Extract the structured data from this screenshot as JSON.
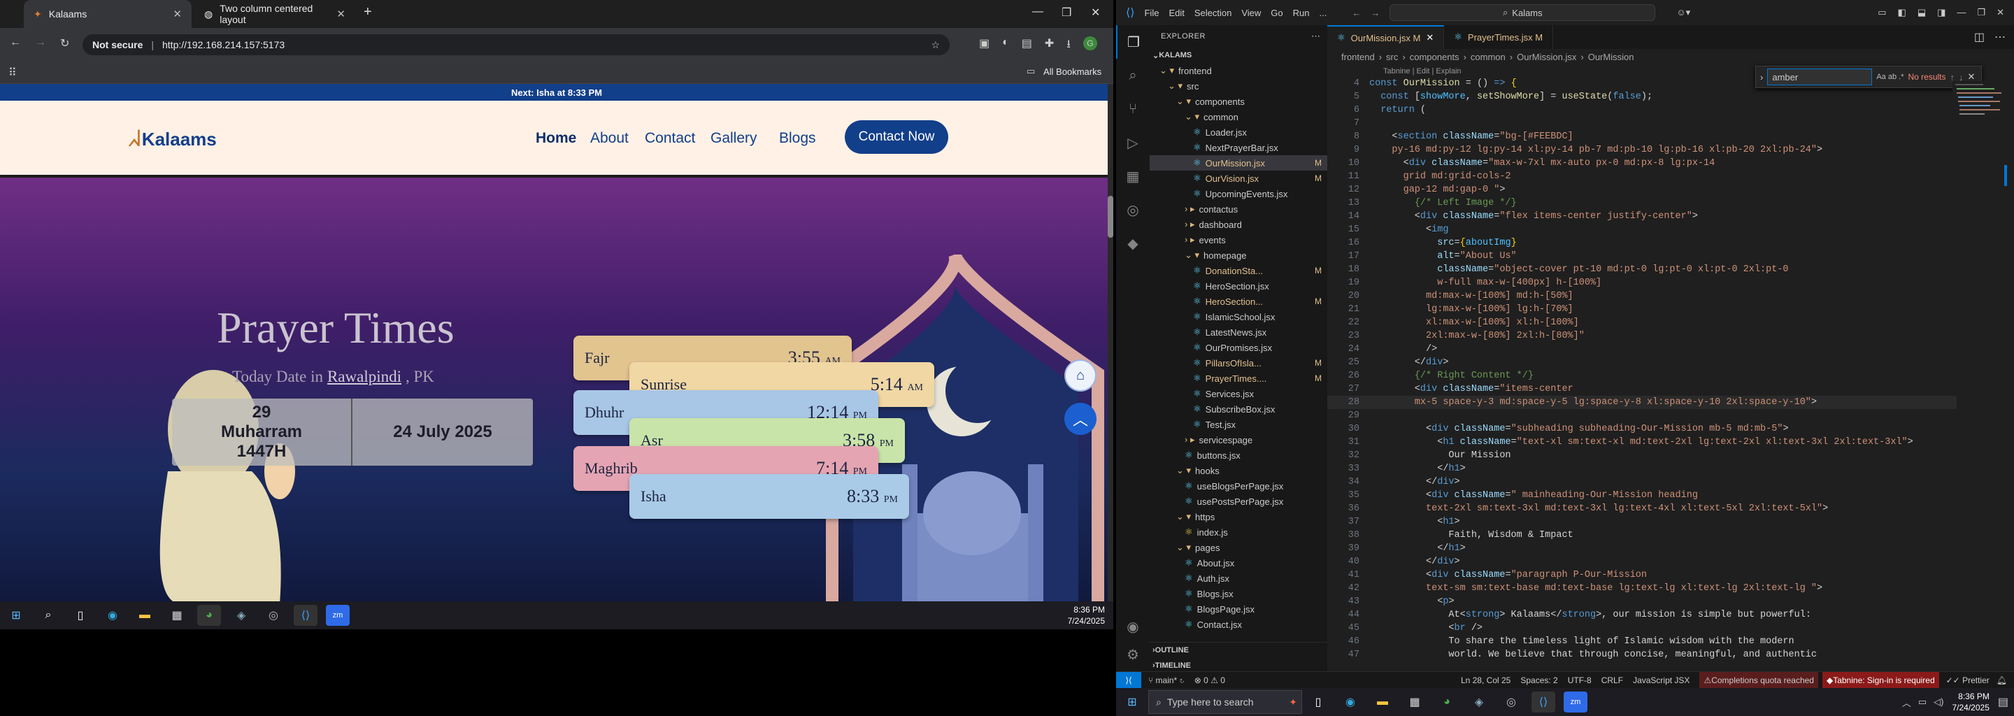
{
  "browser": {
    "tabs": [
      {
        "title": "Kalaams"
      },
      {
        "title": "Two column centered layout"
      }
    ],
    "security": "Not secure",
    "url": "http://192.168.214.157:5173",
    "bookmarks_label": "All Bookmarks"
  },
  "site": {
    "announcement": "Next: Isha at 8:33 PM",
    "logo_text": "Kalaams",
    "nav": [
      "Home",
      "About",
      "Contact",
      "Gallery",
      "Blogs"
    ],
    "contact_button": "Contact Now",
    "hero_title": "Prayer Times",
    "today_label": "Today Date in",
    "city": "Rawalpindi",
    "country": ", PK",
    "hijri_date": "29 Muharram 1447H",
    "gregorian_date": "24 July 2025",
    "prayers": [
      {
        "name": "Fajr",
        "time": "3:55",
        "ampm": "AM"
      },
      {
        "name": "Sunrise",
        "time": "5:14",
        "ampm": "AM"
      },
      {
        "name": "Dhuhr",
        "time": "12:14",
        "ampm": "PM"
      },
      {
        "name": "Asr",
        "time": "3:58",
        "ampm": "PM"
      },
      {
        "name": "Maghrib",
        "time": "7:14",
        "ampm": "PM"
      },
      {
        "name": "Isha",
        "time": "8:33",
        "ampm": "PM"
      }
    ]
  },
  "taskbar_left": {
    "time": "8:36 PM",
    "date": "7/24/2025"
  },
  "vscode": {
    "menu": [
      "File",
      "Edit",
      "Selection",
      "View",
      "Go",
      "Run",
      "..."
    ],
    "search_box": "Kalams",
    "explorer_title": "EXPLORER",
    "root": "KALAMS",
    "tree": [
      {
        "label": "frontend",
        "type": "folder",
        "depth": 0
      },
      {
        "label": "src",
        "type": "folder",
        "depth": 1
      },
      {
        "label": "components",
        "type": "folder",
        "depth": 2
      },
      {
        "label": "common",
        "type": "folder",
        "depth": 3
      },
      {
        "label": "Loader.jsx",
        "type": "file",
        "depth": 4,
        "mark": ""
      },
      {
        "label": "NextPrayerBar.jsx",
        "type": "file",
        "depth": 4,
        "mark": ""
      },
      {
        "label": "OurMission.jsx",
        "type": "file",
        "depth": 4,
        "mark": "M",
        "active": true
      },
      {
        "label": "OurVision.jsx",
        "type": "file",
        "depth": 4,
        "mark": "M"
      },
      {
        "label": "UpcomingEvents.jsx",
        "type": "file",
        "depth": 4,
        "mark": ""
      },
      {
        "label": "contactus",
        "type": "cfolder",
        "depth": 3
      },
      {
        "label": "dashboard",
        "type": "cfolder",
        "depth": 3
      },
      {
        "label": "events",
        "type": "cfolder",
        "depth": 3
      },
      {
        "label": "homepage",
        "type": "folder",
        "depth": 3
      },
      {
        "label": "DonationSta...",
        "type": "file",
        "depth": 4,
        "mark": "M"
      },
      {
        "label": "HeroSection.jsx",
        "type": "file",
        "depth": 4,
        "mark": ""
      },
      {
        "label": "HeroSection...",
        "type": "file",
        "depth": 4,
        "mark": "M"
      },
      {
        "label": "IslamicSchool.jsx",
        "type": "file",
        "depth": 4,
        "mark": ""
      },
      {
        "label": "LatestNews.jsx",
        "type": "file",
        "depth": 4,
        "mark": ""
      },
      {
        "label": "OurPromises.jsx",
        "type": "file",
        "depth": 4,
        "mark": ""
      },
      {
        "label": "PillarsOfIsla...",
        "type": "file",
        "depth": 4,
        "mark": "M"
      },
      {
        "label": "PrayerTimes....",
        "type": "file",
        "depth": 4,
        "mark": "M"
      },
      {
        "label": "Services.jsx",
        "type": "file",
        "depth": 4,
        "mark": ""
      },
      {
        "label": "SubscribeBox.jsx",
        "type": "file",
        "depth": 4,
        "mark": ""
      },
      {
        "label": "Test.jsx",
        "type": "file",
        "depth": 4,
        "mark": ""
      },
      {
        "label": "servicespage",
        "type": "cfolder",
        "depth": 3
      },
      {
        "label": "buttons.jsx",
        "type": "file",
        "depth": 3,
        "mark": ""
      },
      {
        "label": "hooks",
        "type": "folder",
        "depth": 2
      },
      {
        "label": "useBlogsPerPage.jsx",
        "type": "file",
        "depth": 3,
        "mark": ""
      },
      {
        "label": "usePostsPerPage.jsx",
        "type": "file",
        "depth": 3,
        "mark": ""
      },
      {
        "label": "https",
        "type": "folder",
        "depth": 2
      },
      {
        "label": "index.js",
        "type": "file",
        "depth": 3,
        "mark": ""
      },
      {
        "label": "pages",
        "type": "folder",
        "depth": 2
      },
      {
        "label": "About.jsx",
        "type": "file",
        "depth": 3,
        "mark": ""
      },
      {
        "label": "Auth.jsx",
        "type": "file",
        "depth": 3,
        "mark": ""
      },
      {
        "label": "Blogs.jsx",
        "type": "file",
        "depth": 3,
        "mark": ""
      },
      {
        "label": "BlogsPage.jsx",
        "type": "file",
        "depth": 3,
        "mark": ""
      },
      {
        "label": "Contact.jsx",
        "type": "file",
        "depth": 3,
        "mark": ""
      }
    ],
    "outline": "OUTLINE",
    "timeline": "TIMELINE",
    "editor_tabs": [
      {
        "label": "OurMission.jsx M",
        "active": true
      },
      {
        "label": "PrayerTimes.jsx M",
        "active": false
      }
    ],
    "breadcrumb": [
      "frontend",
      "src",
      "components",
      "common",
      "OurMission.jsx",
      "OurMission"
    ],
    "codelens": "Tabnine | Edit | Explain",
    "find": {
      "query": "amber",
      "result": "No results"
    },
    "code_lines": [
      {
        "n": 4,
        "h": "<span class='kw'>const</span> <span class='fn'>OurMission</span> = () <span class='kw'>=&gt;</span> <span class='pu'>{</span>"
      },
      {
        "n": 5,
        "h": "  <span class='kw'>const</span> [<span class='vr'>showMore</span>, <span class='fn'>setShowMore</span>] = <span class='fn'>useState</span>(<span class='kw'>false</span>);"
      },
      {
        "n": 6,
        "h": "  <span class='kw'>return</span> ("
      },
      {
        "n": 7,
        "h": ""
      },
      {
        "n": 8,
        "h": "    &lt;<span class='tg'>section</span> <span class='at'>className</span>=<span class='st'>\"bg-[#FEEBDC]</span>"
      },
      {
        "n": 9,
        "h": "<span class='st'>    py-16 md:py-12 lg:py-14 xl:py-14 pb-7 md:pb-10 lg:pb-16 xl:pb-20 2xl:pb-24\"</span>&gt;"
      },
      {
        "n": 10,
        "h": "      &lt;<span class='tg'>div</span> <span class='at'>className</span>=<span class='st'>\"max-w-7xl mx-auto px-0 md:px-8 lg:px-14</span>"
      },
      {
        "n": 11,
        "h": "<span class='st'>      grid md:grid-cols-2</span>"
      },
      {
        "n": 12,
        "h": "<span class='st'>      gap-12 md:gap-0 \"</span>&gt;"
      },
      {
        "n": 13,
        "h": "        <span class='cm'>{/* Left Image */}</span>"
      },
      {
        "n": 14,
        "h": "        &lt;<span class='tg'>div</span> <span class='at'>className</span>=<span class='st'>\"flex items-center justify-center\"</span>&gt;"
      },
      {
        "n": 15,
        "h": "          &lt;<span class='tg'>img</span>"
      },
      {
        "n": 16,
        "h": "            <span class='at'>src</span>=<span class='pu'>{</span><span class='vr'>aboutImg</span><span class='pu'>}</span>"
      },
      {
        "n": 17,
        "h": "            <span class='at'>alt</span>=<span class='st'>\"About Us\"</span>"
      },
      {
        "n": 18,
        "h": "            <span class='at'>className</span>=<span class='st'>\"object-cover pt-10 md:pt-0 lg:pt-0 xl:pt-0 2xl:pt-0</span>"
      },
      {
        "n": 19,
        "h": "<span class='st'>            w-full max-w-[400px] h-[100%]</span>"
      },
      {
        "n": 20,
        "h": "<span class='st'>          md:max-w-[100%] md:h-[50%]</span>"
      },
      {
        "n": 21,
        "h": "<span class='st'>          lg:max-w-[100%] lg:h-[70%]</span>"
      },
      {
        "n": 22,
        "h": "<span class='st'>          xl:max-w-[100%] xl:h-[100%]</span>"
      },
      {
        "n": 23,
        "h": "<span class='st'>          2xl:max-w-[80%] 2xl:h-[80%]\"</span>"
      },
      {
        "n": 24,
        "h": "          /&gt;"
      },
      {
        "n": 25,
        "h": "        &lt;/<span class='tg'>div</span>&gt;"
      },
      {
        "n": 26,
        "h": "        <span class='cm'>{/* Right Content */}</span>"
      },
      {
        "n": 27,
        "h": "        &lt;<span class='tg'>div</span> <span class='at'>className</span>=<span class='st'>\"items-center</span>"
      },
      {
        "n": 28,
        "h": "<span class='st'>        mx-5 space-y-3 md:space-y-5 lg:space-y-8 xl:space-y-10 2xl:space-y-10\"</span>&gt;"
      },
      {
        "n": 29,
        "h": ""
      },
      {
        "n": 30,
        "h": "          &lt;<span class='tg'>div</span> <span class='at'>className</span>=<span class='st'>\"subheading subheading-Our-Mission mb-5 md:mb-5\"</span>&gt;"
      },
      {
        "n": 31,
        "h": "            &lt;<span class='tg'>h1</span> <span class='at'>className</span>=<span class='st'>\"text-xl sm:text-xl md:text-2xl lg:text-2xl xl:text-3xl 2xl:text-3xl\"</span>&gt;"
      },
      {
        "n": 32,
        "h": "              Our Mission"
      },
      {
        "n": 33,
        "h": "            &lt;/<span class='tg'>h1</span>&gt;"
      },
      {
        "n": 34,
        "h": "          &lt;/<span class='tg'>div</span>&gt;"
      },
      {
        "n": 35,
        "h": "          &lt;<span class='tg'>div</span> <span class='at'>className</span>=<span class='st'>\" mainheading-Our-Mission heading</span>"
      },
      {
        "n": 36,
        "h": "<span class='st'>          text-2xl sm:text-3xl md:text-3xl lg:text-4xl xl:text-5xl 2xl:text-5xl\"</span>&gt;"
      },
      {
        "n": 37,
        "h": "            &lt;<span class='tg'>h1</span>&gt;"
      },
      {
        "n": 38,
        "h": "              Faith, Wisdom &amp; Impact"
      },
      {
        "n": 39,
        "h": "            &lt;/<span class='tg'>h1</span>&gt;"
      },
      {
        "n": 40,
        "h": "          &lt;/<span class='tg'>div</span>&gt;"
      },
      {
        "n": 41,
        "h": "          &lt;<span class='tg'>div</span> <span class='at'>className</span>=<span class='st'>\"paragraph P-Our-Mission</span>"
      },
      {
        "n": 42,
        "h": "<span class='st'>          text-sm sm:text-base md:text-base lg:text-lg xl:text-lg 2xl:text-lg \"</span>&gt;"
      },
      {
        "n": 43,
        "h": "            &lt;<span class='tg'>p</span>&gt;"
      },
      {
        "n": 44,
        "h": "              At&lt;<span class='tg'>strong</span>&gt; Kalaams&lt;/<span class='tg'>strong</span>&gt;, our mission is simple but powerful:"
      },
      {
        "n": 45,
        "h": "              &lt;<span class='tg'>br</span> /&gt;"
      },
      {
        "n": 46,
        "h": "              To share the timeless light of Islamic wisdom with the modern"
      },
      {
        "n": 47,
        "h": "              world. We believe that through concise, meaningful, and authentic"
      }
    ],
    "status": {
      "branch": "main*",
      "errors": "⊗ 0 ⚠ 0",
      "position": "Ln 28, Col 25",
      "spaces": "Spaces: 2",
      "encoding": "UTF-8",
      "eol": "CRLF",
      "language": "JavaScript JSX",
      "quota": "Completions quota reached",
      "tabnine": "Tabnine: Sign-in is required",
      "prettier": "Prettier"
    }
  },
  "taskbar_right": {
    "search_placeholder": "Type here to search",
    "time": "8:36 PM",
    "date": "7/24/2025"
  }
}
